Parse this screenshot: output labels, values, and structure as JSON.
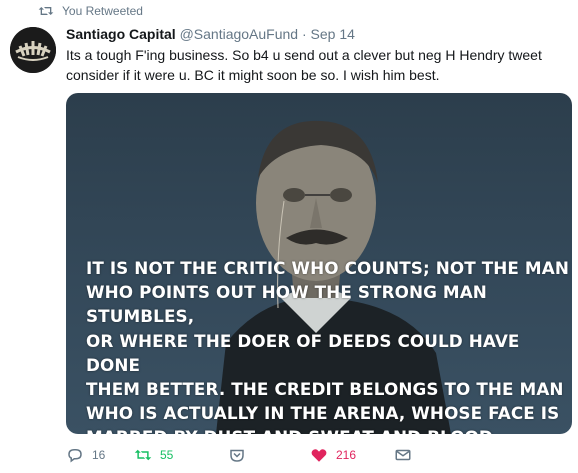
{
  "retweet_banner": {
    "text": "You Retweeted"
  },
  "tweet": {
    "author_name": "Santiago Capital",
    "author_handle": "@SantiagoAuFund",
    "separator": "·",
    "time": "Sep 14",
    "text": "Its a tough F'ing business. So b4 u send out a clever but neg H Hendry tweet consider if it were u. BC it might soon be so. I wish him best."
  },
  "media": {
    "quote_lines": [
      "IT IS NOT THE CRITIC WHO COUNTS; NOT THE MAN",
      "WHO POINTS OUT HOW THE STRONG MAN STUMBLES,",
      "OR WHERE THE DOER OF DEEDS COULD HAVE DONE",
      "THEM BETTER. THE CREDIT BELONGS TO THE MAN",
      "WHO IS ACTUALLY IN THE ARENA, WHOSE FACE IS",
      "MARRED BY DUST AND SWEAT AND BLOOD."
    ]
  },
  "actions": {
    "reply_count": "16",
    "retweet_count": "55",
    "like_count": "216"
  },
  "colors": {
    "retweet_active": "#17bf63",
    "like_active": "#e0245e",
    "muted": "#657786"
  },
  "icons": {
    "retweet_banner": "retweet-icon",
    "reply": "reply-icon",
    "retweet": "retweet-icon",
    "direct_message": "message-icon",
    "like": "heart-icon",
    "mail": "mail-icon"
  }
}
